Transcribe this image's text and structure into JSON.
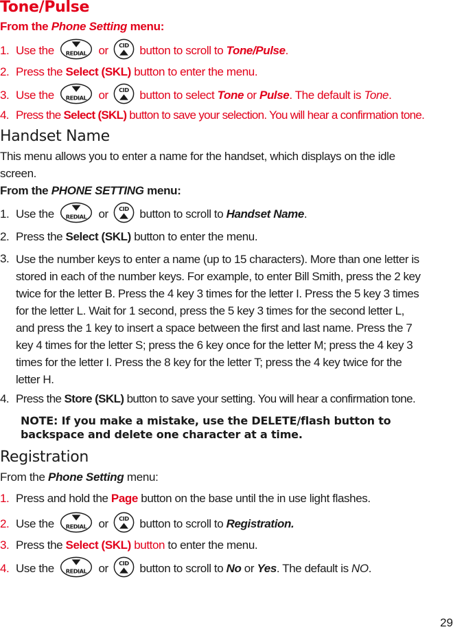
{
  "page_number": "29",
  "colors": {
    "accent": "#e2001a",
    "text": "#1a1a1a"
  },
  "icons": {
    "redial": {
      "name": "redial-down-button-icon",
      "label": "REDIAL"
    },
    "cid": {
      "name": "cid-up-button-icon",
      "label": "CID"
    }
  },
  "tone_pulse": {
    "title": "Tone/Pulse",
    "from_prefix": "From the ",
    "from_menu": "Phone Setting",
    "from_suffix": " menu:",
    "steps": [
      {
        "num": "1.",
        "pre": "Use the ",
        "mid": " or ",
        "post": " button to scroll to ",
        "target": "Tone/Pulse",
        "end": "."
      },
      {
        "num": "2.",
        "pre": "Press the ",
        "bold": "Select (SKL)",
        "post": " button to enter the menu."
      },
      {
        "num": "3.",
        "pre": "Use the ",
        "mid": " or ",
        "post": " button to select ",
        "opt1": "Tone",
        "or": " or ",
        "opt2": "Pulse",
        "after": ". The default is ",
        "default": "Tone",
        "end": "."
      },
      {
        "num": "4.",
        "pre": "Press the ",
        "bold": "Select (SKL)",
        "post": " button to save your selection. You will hear a confirmation tone."
      }
    ]
  },
  "handset_name": {
    "title": "Handset Name",
    "intro": "This menu allows you to enter a name for the handset, which displays on the idle screen.",
    "intro_line1": "This menu allows you to enter a name for the handset, which displays on the idle",
    "intro_line2": "screen.",
    "from_prefix": "From the ",
    "from_menu": "PHONE SETTING",
    "from_suffix": " menu:",
    "steps": [
      {
        "num": "1.",
        "pre": "Use the ",
        "mid": " or ",
        "post": " button to scroll to ",
        "target": "Handset Name",
        "end": "."
      },
      {
        "num": "2.",
        "pre": "Press the ",
        "bold": "Select (SKL)",
        "post": " button to enter the menu."
      },
      {
        "num": "3.",
        "lines": [
          "Use the number keys to enter a name (up to 15 characters). More than one letter is",
          "stored in each of the number keys. For example, to enter Bill Smith, press the 2 key",
          "twice for the letter B. Press the 4 key 3 times for the letter I. Press the 5 key 3 times",
          "for the letter L. Wait for 1 second, press the 5 key 3 times for the second letter L,",
          "and press the 1 key to insert a space between the first and last name. Press the 7",
          "key 4 times for the letter S; press the 6 key once for the letter M; press the 4 key 3",
          "times for the letter I. Press the 8 key for the letter T; press the 4 key twice for the",
          "letter H."
        ]
      },
      {
        "num": "4.",
        "pre": "Press the ",
        "bold": "Store (SKL)",
        "post": " button to save your setting. You will hear a confirmation tone."
      }
    ],
    "note_line1": "NOTE: If you make a mistake, use the DELETE/flash button to",
    "note_line2": "backspace and delete one character at a time."
  },
  "registration": {
    "title": "Registration",
    "from_prefix": "From the ",
    "from_menu": "Phone Setting",
    "from_suffix": " menu:",
    "steps": [
      {
        "num": "1.",
        "pre": "Press and hold the ",
        "bold": "Page",
        "post": " button on the base until the in use light flashes."
      },
      {
        "num": "2.",
        "pre": "Use the ",
        "mid": " or ",
        "post": " button to scroll to ",
        "target": "Registration.",
        "end": ""
      },
      {
        "num": "3.",
        "pre": "Press the ",
        "bold": "Select (SKL)",
        "red_tail": " button",
        "post": " to enter the menu."
      },
      {
        "num": "4.",
        "pre": "Use the ",
        "mid": " or ",
        "post": " button to scroll to ",
        "opt1": "No",
        "or": " or ",
        "opt2": "Yes",
        "after": ". The default is ",
        "default": "NO",
        "end": "."
      }
    ]
  }
}
